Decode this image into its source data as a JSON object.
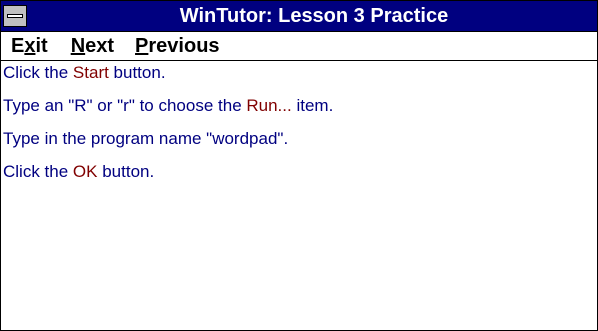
{
  "window": {
    "title": "WinTutor: Lesson 3 Practice",
    "title_bar_color": "#000080",
    "system_menu_icon": "system-menu-icon"
  },
  "menu": [
    {
      "accel": "",
      "u": "x",
      "rest": "it",
      "pre": "E"
    },
    {
      "pre": "",
      "u": "N",
      "rest": "ext"
    },
    {
      "pre": "",
      "u": "P",
      "rest": "revious"
    }
  ],
  "steps": [
    {
      "before": "Click the ",
      "highlight": "Start",
      "after": " button."
    },
    {
      "before": "Type an \"R\" or \"r\" to choose the ",
      "highlight": "Run...",
      "after": " item."
    },
    {
      "before": "Type in the program name \"wordpad\".",
      "highlight": "",
      "after": ""
    },
    {
      "before": "Click the ",
      "highlight": "OK",
      "after": " button."
    }
  ],
  "colors": {
    "instruction_text": "#000080",
    "highlight_text": "#800000"
  }
}
